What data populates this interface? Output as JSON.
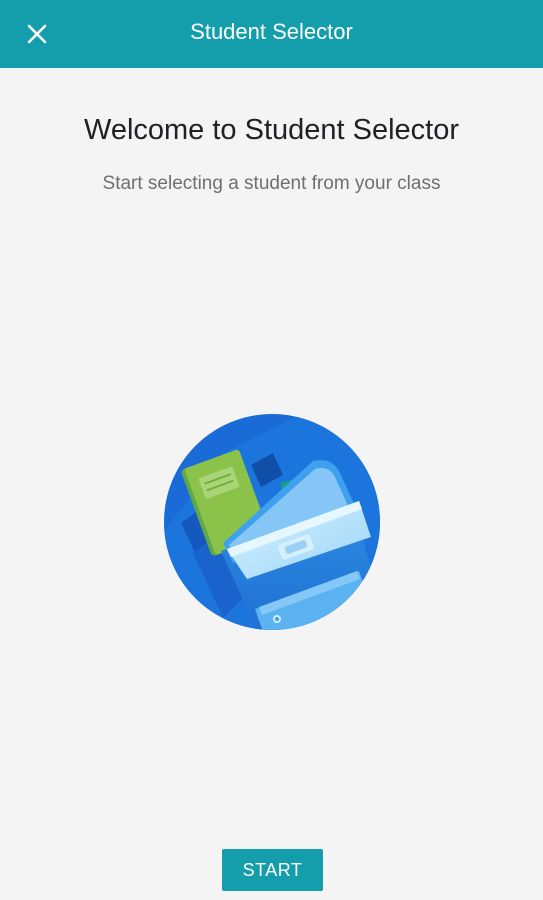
{
  "app_bar": {
    "title": "Student Selector",
    "close_icon": "close-icon",
    "background_color": "#149dab"
  },
  "welcome": {
    "headline": "Welcome to Student Selector",
    "subtitle": "Start selecting a student from your class"
  },
  "illustration": {
    "icon": "backpack-illustration"
  },
  "actions": {
    "start_label": "START"
  }
}
